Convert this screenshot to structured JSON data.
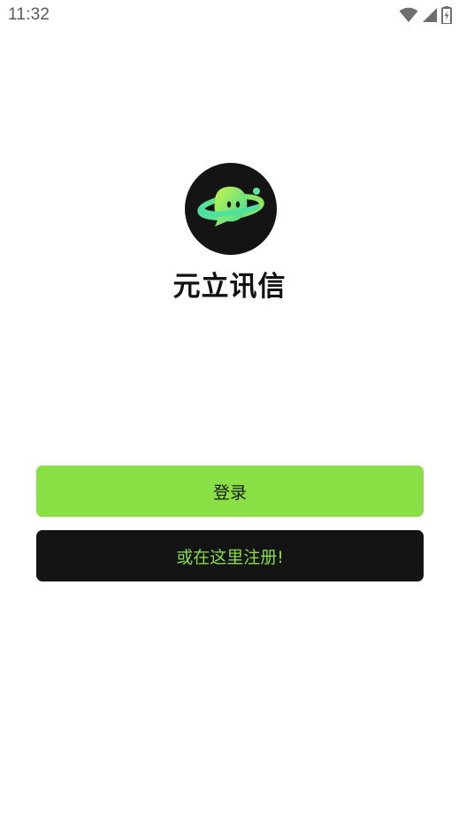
{
  "status_bar": {
    "time": "11:32",
    "icons": [
      "wifi-icon",
      "cellular-signal-icon",
      "battery-charging-icon"
    ]
  },
  "app": {
    "logo_icon": "planet-mascot-logo",
    "name": "元立讯信"
  },
  "actions": {
    "login_label": "登录",
    "register_label": "或在这里注册!"
  },
  "colors": {
    "accent_green": "#88e045",
    "dark": "#141414",
    "register_text": "#86dd44"
  }
}
